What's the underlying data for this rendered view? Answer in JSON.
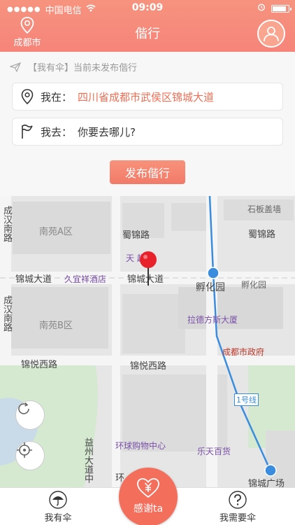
{
  "status": {
    "carrier": "中国电信",
    "time": "09:09"
  },
  "header": {
    "location": "成都市",
    "title": "偕行"
  },
  "notice": "【我有伞】当前未发布偕行",
  "form": {
    "from_label": "我在：",
    "from_value": "四川省成都市武侯区锦城大道",
    "to_label": "我去：",
    "to_placeholder": "你要去哪儿?",
    "publish_label": "发布偕行"
  },
  "map": {
    "labels": {
      "shiban": "石板盖墙",
      "chenghan1": "成汉南路",
      "nanyuanA": "南苑A区",
      "shujin1": "蜀锦路",
      "shujin2": "蜀锦路",
      "market": "天 超市",
      "jincheng1": "锦城大道",
      "jiuyi": "久宜祥酒店",
      "jincheng2": "锦城大道",
      "fuhua1": "孵化园",
      "fuhua2": "孵化园",
      "chenghan2": "成汉南路",
      "nanyuanB": "南苑B区",
      "ladefang": "拉德方斯大厦",
      "gov": "成都市政府",
      "jinyue1": "锦悦西路",
      "jinyue2": "锦悦西路",
      "line1": "1号线",
      "yizhou": "益州大道中",
      "huanqiu": "环球购物中心",
      "letian": "乐天百货",
      "huan": "环",
      "jinchengguang": "锦城广场"
    }
  },
  "tabs": {
    "left": "我有伞",
    "center": "感谢ta",
    "right": "我需要伞"
  }
}
